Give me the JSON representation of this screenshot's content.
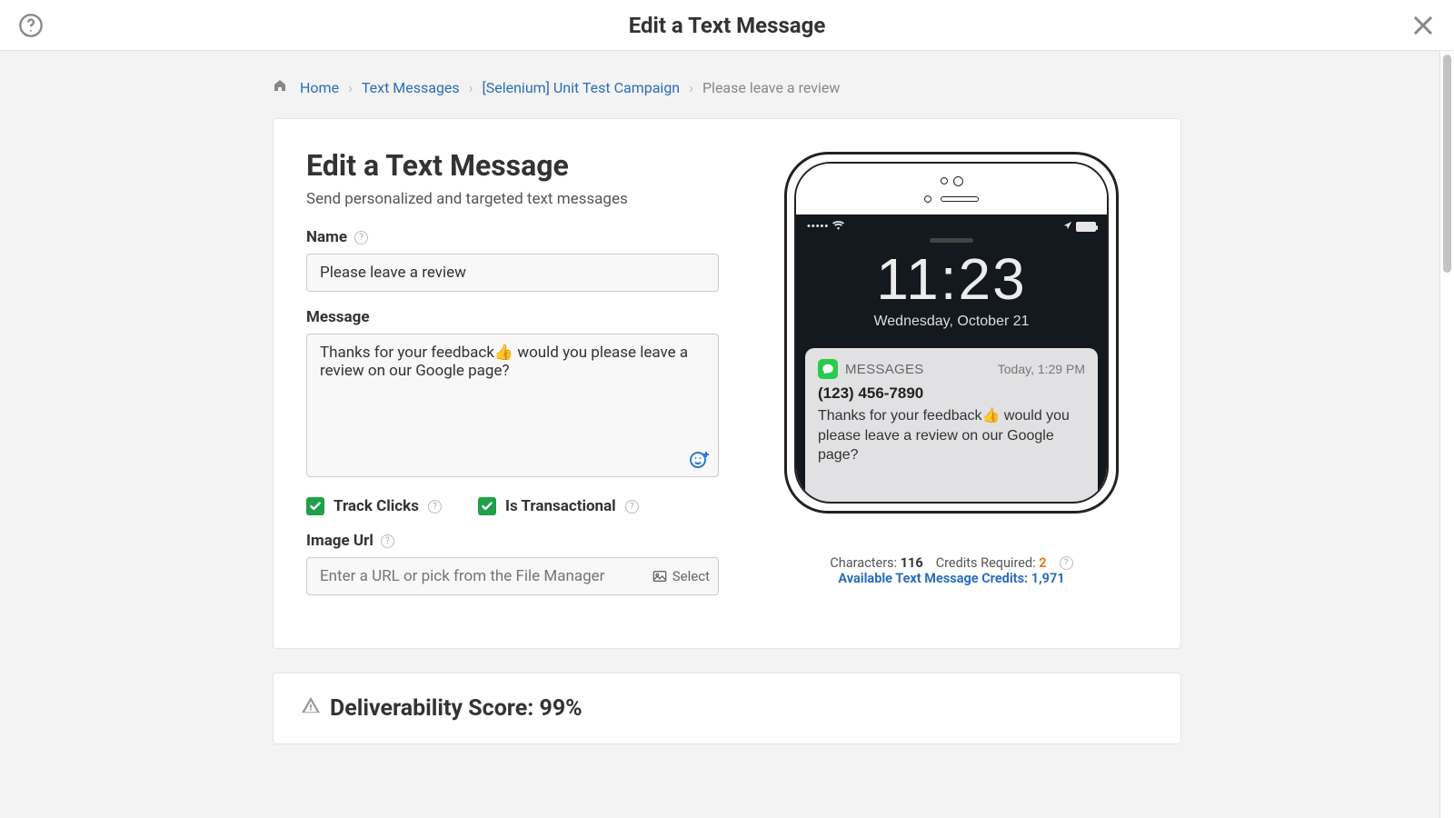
{
  "header": {
    "title": "Edit a Text Message"
  },
  "breadcrumb": {
    "home": "Home",
    "item1": "Text Messages",
    "item2": "[Selenium] Unit Test Campaign",
    "current": "Please leave a review"
  },
  "form": {
    "heading": "Edit a Text Message",
    "subtitle": "Send personalized and targeted text messages",
    "name_label": "Name",
    "name_value": "Please leave a review",
    "message_label": "Message",
    "message_value": "Thanks for your feedback👍 would you please leave a review on our Google page?",
    "track_clicks_label": "Track Clicks",
    "track_clicks_checked": true,
    "is_transactional_label": "Is Transactional",
    "is_transactional_checked": true,
    "image_url_label": "Image Url",
    "image_url_placeholder": "Enter a URL or pick from the File Manager",
    "select_label": "Select"
  },
  "preview": {
    "time": "11:23",
    "date": "Wednesday, October 21",
    "app_name": "MESSAGES",
    "notif_time": "Today, 1:29 PM",
    "from": "(123) 456-7890",
    "body": "Thanks for your feedback👍 would you please leave a review on our Google page?"
  },
  "stats": {
    "characters_label": "Characters:",
    "characters_value": "116",
    "credits_required_label": "Credits Required:",
    "credits_required_value": "2",
    "available_label": "Available Text Message Credits:",
    "available_value": "1,971"
  },
  "deliverability": {
    "label_prefix": "Deliverability Score: ",
    "score": "99%"
  }
}
